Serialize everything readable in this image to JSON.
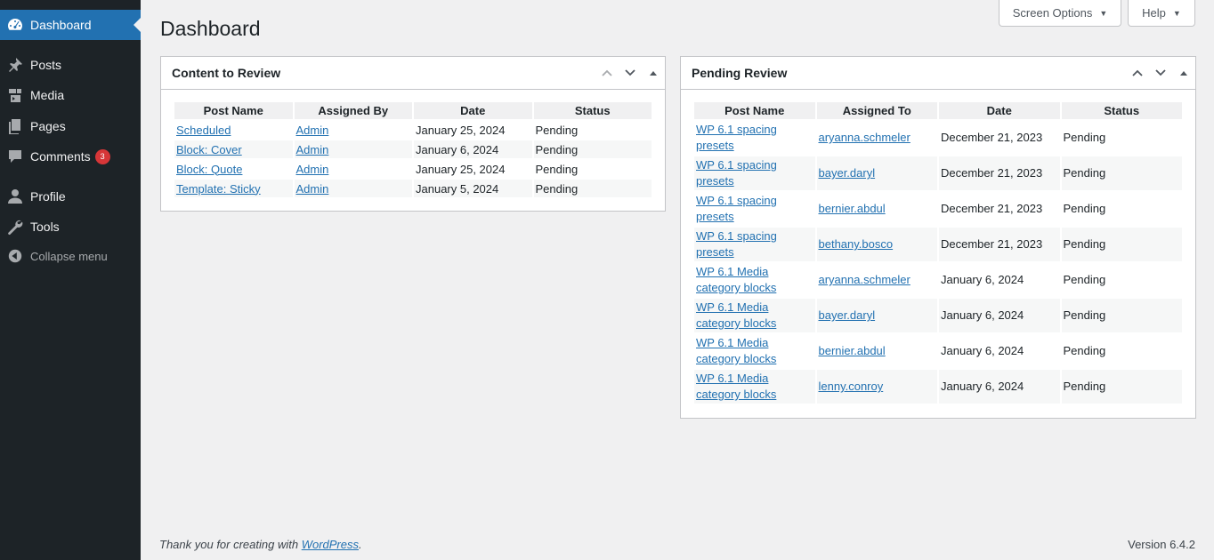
{
  "sidebar": {
    "items": [
      {
        "label": "Dashboard",
        "icon": "dashboard-icon"
      },
      {
        "label": "Posts",
        "icon": "pin-icon"
      },
      {
        "label": "Media",
        "icon": "media-icon"
      },
      {
        "label": "Pages",
        "icon": "pages-icon"
      },
      {
        "label": "Comments",
        "icon": "comment-icon",
        "badge": "3"
      },
      {
        "label": "Profile",
        "icon": "user-icon"
      },
      {
        "label": "Tools",
        "icon": "wrench-icon"
      }
    ],
    "collapse_label": "Collapse menu"
  },
  "header": {
    "screen_options_label": "Screen Options",
    "help_label": "Help",
    "title": "Dashboard"
  },
  "content_to_review": {
    "title": "Content to Review",
    "columns": [
      "Post Name",
      "Assigned By",
      "Date",
      "Status"
    ],
    "rows": [
      {
        "post": "Scheduled",
        "by": "Admin",
        "date": "January 25, 2024",
        "status": "Pending"
      },
      {
        "post": "Block: Cover",
        "by": "Admin",
        "date": "January 6, 2024",
        "status": "Pending"
      },
      {
        "post": "Block: Quote",
        "by": "Admin",
        "date": "January 25, 2024",
        "status": "Pending"
      },
      {
        "post": "Template: Sticky",
        "by": "Admin",
        "date": "January 5, 2024",
        "status": "Pending"
      }
    ]
  },
  "pending_review": {
    "title": "Pending Review",
    "columns": [
      "Post Name",
      "Assigned To",
      "Date",
      "Status"
    ],
    "rows": [
      {
        "post": "WP 6.1 spacing presets",
        "to": "aryanna.schmeler",
        "date": "December 21, 2023",
        "status": "Pending"
      },
      {
        "post": "WP 6.1 spacing presets",
        "to": "bayer.daryl",
        "date": "December 21, 2023",
        "status": "Pending"
      },
      {
        "post": "WP 6.1 spacing presets",
        "to": "bernier.abdul",
        "date": "December 21, 2023",
        "status": "Pending"
      },
      {
        "post": "WP 6.1 spacing presets",
        "to": "bethany.bosco",
        "date": "December 21, 2023",
        "status": "Pending"
      },
      {
        "post": "WP 6.1 Media category blocks",
        "to": "aryanna.schmeler",
        "date": "January 6, 2024",
        "status": "Pending"
      },
      {
        "post": "WP 6.1 Media category blocks",
        "to": "bayer.daryl",
        "date": "January 6, 2024",
        "status": "Pending"
      },
      {
        "post": "WP 6.1 Media category blocks",
        "to": "bernier.abdul",
        "date": "January 6, 2024",
        "status": "Pending"
      },
      {
        "post": "WP 6.1 Media category blocks",
        "to": "lenny.conroy",
        "date": "January 6, 2024",
        "status": "Pending"
      }
    ]
  },
  "footer": {
    "thanks_prefix": "Thank you for creating with ",
    "wordpress_link": "WordPress",
    "thanks_suffix": ".",
    "version": "Version 6.4.2"
  },
  "colors": {
    "sidebar_bg": "#1d2327",
    "accent": "#2271b1",
    "badge": "#d63638",
    "page_bg": "#f0f0f1"
  }
}
